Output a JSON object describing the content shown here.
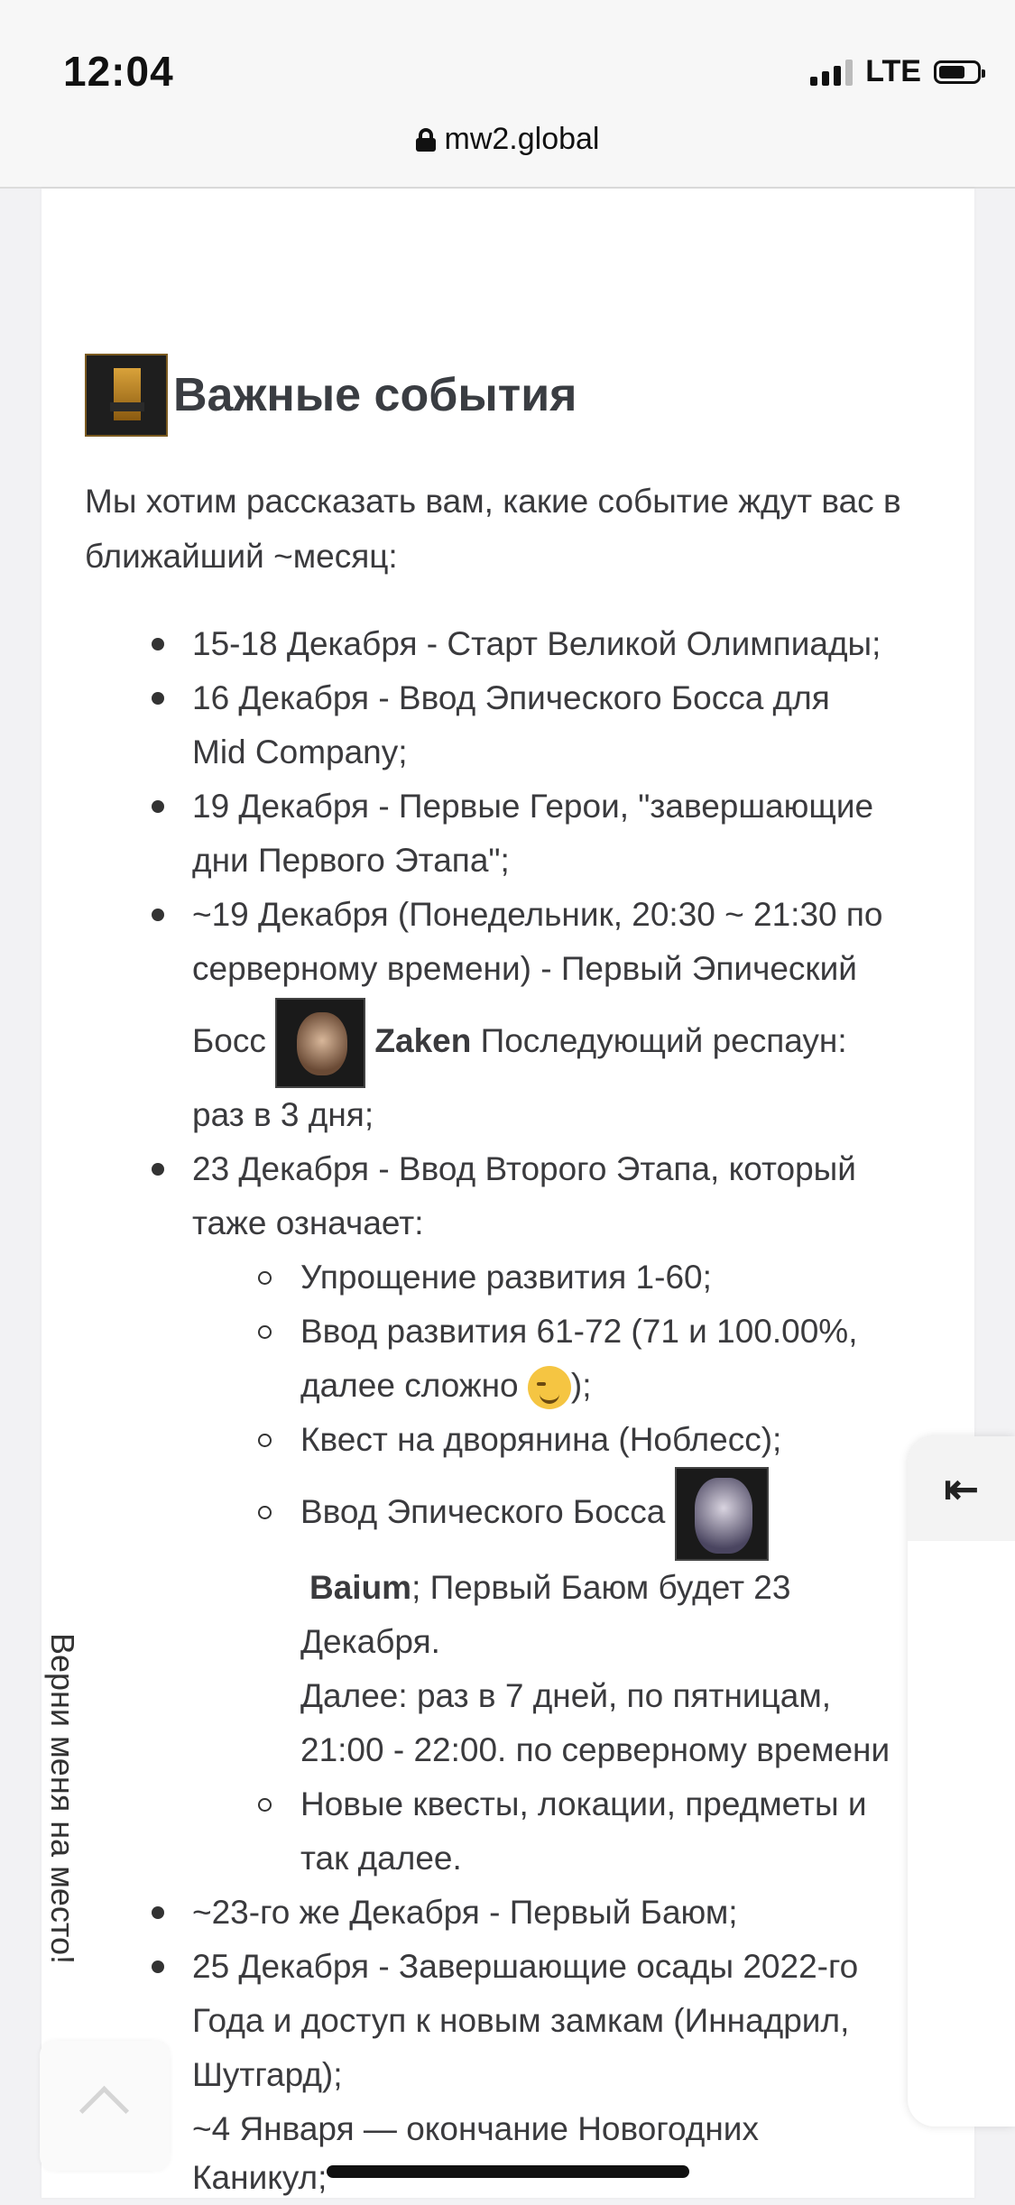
{
  "status_bar": {
    "time": "12:04",
    "network": "LTE"
  },
  "browser": {
    "url": "mw2.global"
  },
  "article": {
    "heading": "Важные события",
    "intro": "Мы хотим рассказать вам, какие событие ждут вас в ближайший ~месяц:",
    "items": [
      "15-18 Декабря - Старт Великой Олимпиады;",
      "16 Декабря - Ввод Эпического Босса для",
      "Mid Company;",
      "19 Декабря - Первые Герои, \"завершающие",
      "дни Первого Этапа\";",
      "~19 Декабря (Понедельник, 20:30 ~ 21:30 по",
      "серверному времени) - Первый Эпический",
      "Босс",
      "Zaken",
      "Последующий респаун:",
      "раз в 3 дня;",
      "23 Декабря - Ввод Второго Этапа, который",
      "таже означает:"
    ],
    "subitems": [
      "Упрощение развития 1-60;",
      "Ввод развития 61-72 (71 и 100.00%,",
      "далее сложно",
      ");",
      "Квест на дворянина (Ноблесс);",
      "Ввод Эпического Босса",
      "Baium",
      "; Первый Баюм будет 23",
      "Декабря.",
      "Далее: раз в 7 дней, по пятницам,",
      "21:00 - 22:00. по серверному времени",
      "Новые квесты, локации, предметы и",
      "так далее."
    ],
    "tail": [
      "~23-го же Декабря - Первый Баюм;",
      "25 Декабря - Завершающие осады 2022-го",
      "Года и доступ к новым замкам (Иннадрил,",
      "Шутгард);",
      "~4 Января — окончание Новогодних",
      "Каникул;"
    ]
  },
  "side_panel": {
    "button_glyph": "⇤",
    "label": "Верни меня на место!"
  }
}
